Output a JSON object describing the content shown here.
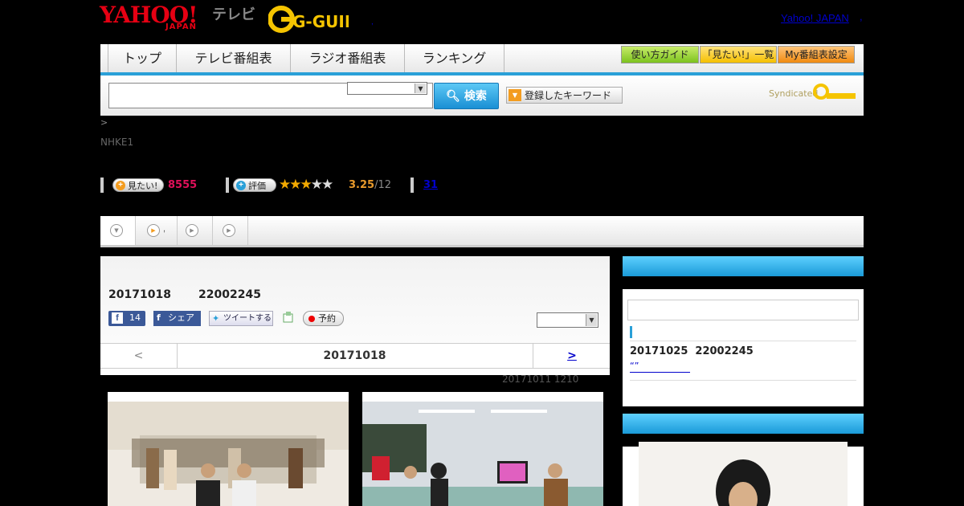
{
  "header": {
    "logo_yahoo": "YAHOO!",
    "logo_japan": "JAPAN",
    "logo_tv": "テレビ",
    "logo_gguide": "G-GUIDE",
    "yahoo_japan_link": "Yahoo! JAPAN",
    "comma": ",",
    "dot": ","
  },
  "nav": {
    "tabs": [
      "トップ",
      "テレビ番組表",
      "ラジオ番組表",
      "ランキング"
    ],
    "guide_buttons": [
      "使い方ガイド",
      "「見たい!」一覧",
      "My番組表設定"
    ]
  },
  "search": {
    "input_value": "",
    "select_value": "",
    "button_label": "検索",
    "keyword_button": "登録したキーワード",
    "syndicated": "Syndicated"
  },
  "program": {
    "breadcrumb": ">",
    "channel": "NHKE1",
    "mitai_label": "見たい!",
    "mitai_count": "8555",
    "hyoka_label": "評価",
    "rating": "3.25",
    "rating_count": "/12",
    "stars_filled": 3,
    "reviews_link": "31"
  },
  "main": {
    "air_info": "20171018       22002245",
    "share_count": "14",
    "share_label": "シェア",
    "tweet_label": "ツイートする",
    "reserve_label": "予約",
    "select_value": "",
    "prev": "<",
    "date": "20171018",
    "next": ">",
    "prev_broadcast": "20171011  1210"
  },
  "sidebar": {
    "next_air": "20171025  22002245",
    "quote_link": "“”"
  },
  "colors": {
    "accent_blue": "#2aa0d8",
    "mitai_pink": "#e0105a",
    "rating_orange": "#e89a2c",
    "link_blue": "#0000cc"
  }
}
